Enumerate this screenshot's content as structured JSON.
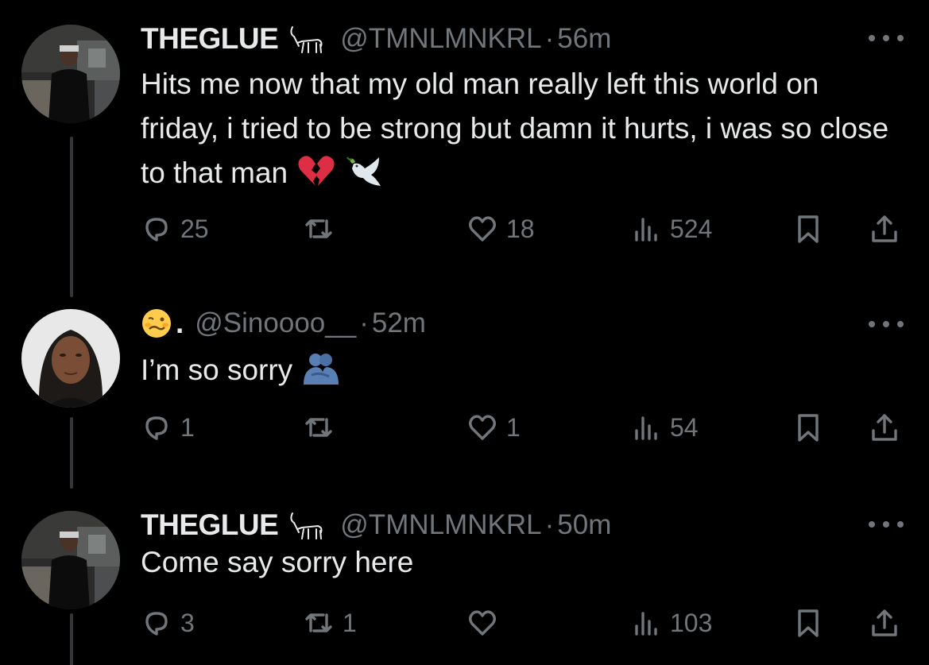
{
  "tweets": [
    {
      "display_name": "THEGLUE",
      "badge_icon": "goat-emoji",
      "handle": "@TMNLMNKRL",
      "separator": "·",
      "time": "56m",
      "text": "Hits me now that my old man really left this world on friday, i tried to be strong but damn it hurts, i was so close to that man",
      "text_emojis": [
        "broken-heart-emoji",
        "dove-emoji"
      ],
      "replies": "25",
      "reposts": "",
      "likes": "18",
      "views": "524"
    },
    {
      "display_name_emoji": "woozy-face-emoji",
      "display_name": ".",
      "handle": "@Sinoooo__",
      "separator": "·",
      "time": "52m",
      "text": "I’m so sorry",
      "text_emojis": [
        "people-hugging-emoji"
      ],
      "replies": "1",
      "reposts": "",
      "likes": "1",
      "views": "54"
    },
    {
      "display_name": "THEGLUE",
      "badge_icon": "goat-emoji",
      "handle": "@TMNLMNKRL",
      "separator": "·",
      "time": "50m",
      "text": "Come say sorry here",
      "text_emojis": [],
      "replies": "3",
      "reposts": "1",
      "likes": "",
      "views": "103"
    }
  ],
  "colors": {
    "background": "#000000",
    "primary_text": "#e7e9ea",
    "secondary_text": "#71767b",
    "thread_line": "#333639"
  }
}
